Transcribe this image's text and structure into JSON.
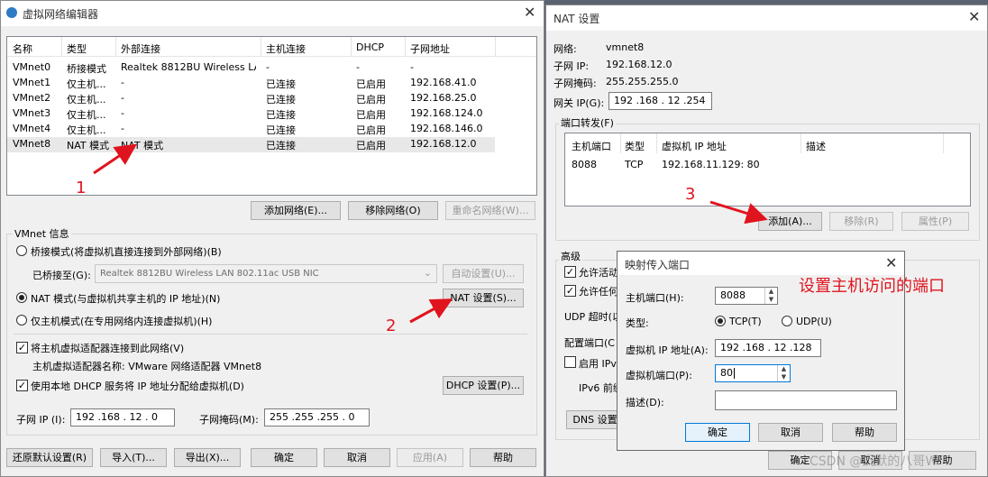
{
  "editor": {
    "title": "虚拟网络编辑器",
    "columns": [
      "名称",
      "类型",
      "外部连接",
      "主机连接",
      "DHCP",
      "子网地址"
    ],
    "rows": [
      [
        "VMnet0",
        "桥接模式",
        "Realtek 8812BU Wireless LA...",
        "-",
        "-",
        "-"
      ],
      [
        "VMnet1",
        "仅主机...",
        "-",
        "已连接",
        "已启用",
        "192.168.41.0"
      ],
      [
        "VMnet2",
        "仅主机...",
        "-",
        "已连接",
        "已启用",
        "192.168.25.0"
      ],
      [
        "VMnet3",
        "仅主机...",
        "-",
        "已连接",
        "已启用",
        "192.168.124.0"
      ],
      [
        "VMnet4",
        "仅主机...",
        "-",
        "已连接",
        "已启用",
        "192.168.146.0"
      ],
      [
        "VMnet8",
        "NAT 模式",
        "NAT 模式",
        "已连接",
        "已启用",
        "192.168.12.0"
      ]
    ],
    "add_network": "添加网络(E)...",
    "remove_network": "移除网络(O)",
    "rename_network": "重命名网络(W)...",
    "vmnet_info": "VMnet 信息",
    "bridge_mode": "桥接模式(将虚拟机直接连接到外部网络)(B)",
    "bridged_to_label": "已桥接至(G):",
    "bridged_to_value": "Realtek 8812BU Wireless LAN 802.11ac USB NIC",
    "auto_settings": "自动设置(U)...",
    "nat_mode": "NAT 模式(与虚拟机共享主机的 IP 地址)(N)",
    "nat_settings": "NAT 设置(S)...",
    "host_only_mode": "仅主机模式(在专用网络内连接虚拟机)(H)",
    "connect_adapter": "将主机虚拟适配器连接到此网络(V)",
    "adapter_name": "主机虚拟适配器名称: VMware 网络适配器 VMnet8",
    "use_dhcp": "使用本地 DHCP 服务将 IP 地址分配给虚拟机(D)",
    "dhcp_settings": "DHCP 设置(P)...",
    "subnet_ip_label": "子网 IP (I):",
    "subnet_ip": "192 .168 . 12 . 0",
    "subnet_mask_label": "子网掩码(M):",
    "subnet_mask": "255 .255 .255 . 0",
    "restore_defaults": "还原默认设置(R)",
    "import": "导入(T)...",
    "export": "导出(X)...",
    "ok": "确定",
    "cancel": "取消",
    "apply": "应用(A)",
    "help": "帮助"
  },
  "nat": {
    "title": "NAT 设置",
    "network_label": "网络:",
    "network_value": "vmnet8",
    "subnet_ip_label": "子网 IP:",
    "subnet_ip_value": "192.168.12.0",
    "subnet_mask_label": "子网掩码:",
    "subnet_mask_value": "255.255.255.0",
    "gateway_label": "网关 IP(G):",
    "gateway_value": "192 .168 . 12 .254",
    "port_forwarding": "端口转发(F)",
    "columns": [
      "主机端口",
      "类型",
      "虚拟机 IP 地址",
      "描述"
    ],
    "rows": [
      [
        "8088",
        "TCP",
        "192.168.11.129: 80",
        ""
      ]
    ],
    "add": "添加(A)...",
    "remove": "移除(R)",
    "properties": "属性(P)",
    "advanced": "高级",
    "allow_active": "允许活动",
    "allow_any": "允许任何",
    "udp_timeout": "UDP 超时(以",
    "config_port": "配置端口(C",
    "enable_ipv6": "启用 IPv",
    "ipv6_prefix": "IPv6 前缀",
    "dns_settings": "DNS 设置",
    "ok": "确定",
    "cancel": "取消",
    "help": "帮助"
  },
  "mapping": {
    "title": "映射传入端口",
    "host_port_label": "主机端口(H):",
    "host_port_value": "8088",
    "type_label": "类型:",
    "tcp": "TCP(T)",
    "udp": "UDP(U)",
    "vm_ip_label": "虚拟机 IP 地址(A):",
    "vm_ip_value": "192 .168 . 12 .128",
    "vm_port_label": "虚拟机端口(P):",
    "vm_port_value": "80",
    "desc_label": "描述(D):",
    "ok": "确定",
    "cancel": "取消",
    "help": "帮助"
  },
  "annotations": {
    "step1": "1",
    "step2": "2",
    "step3": "3",
    "note": "设置主机访问的端口",
    "watermark": "CSDN @沉默的八哥W"
  }
}
